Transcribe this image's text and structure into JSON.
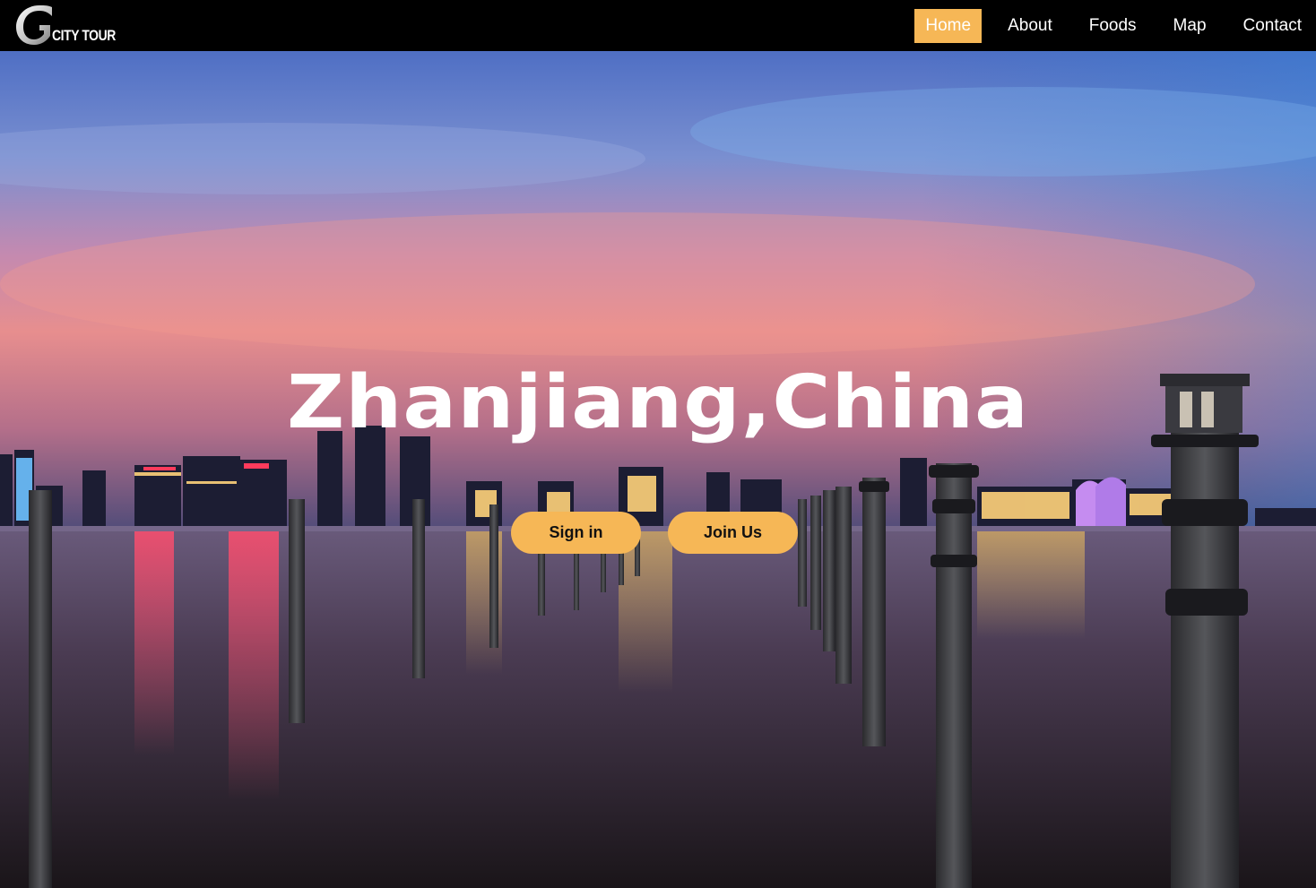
{
  "brand": {
    "logo_text": "CITY TOUR",
    "logo_letter": "G"
  },
  "nav": {
    "items": [
      {
        "label": "Home",
        "active": true
      },
      {
        "label": "About",
        "active": false
      },
      {
        "label": "Foods",
        "active": false
      },
      {
        "label": "Map",
        "active": false
      },
      {
        "label": "Contact",
        "active": false
      }
    ]
  },
  "hero": {
    "title": "Zhanjiang,China",
    "sign_in_label": "Sign in",
    "join_label": "Join Us"
  },
  "colors": {
    "accent": "#f6b756",
    "navbar_bg": "#000000",
    "text": "#ffffff"
  }
}
